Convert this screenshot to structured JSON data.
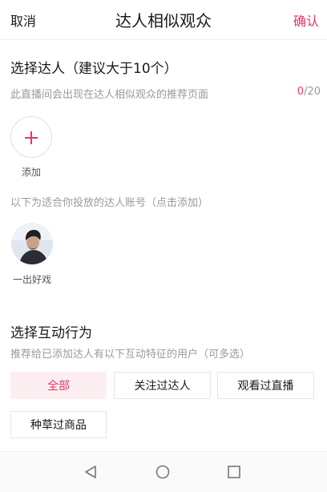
{
  "header": {
    "cancel_label": "取消",
    "title": "达人相似观众",
    "confirm_label": "确认"
  },
  "select_influencer": {
    "title": "选择达人（建议大于10个）",
    "hint": "此直播间会出现在达人相似观众的推荐页面",
    "count_current": "0",
    "count_total": "/20",
    "add_label": "添加"
  },
  "suggested": {
    "hint": "以下为适合你投放的达人账号（点击添加）",
    "accounts": [
      {
        "name": "一出好戏"
      }
    ]
  },
  "interaction": {
    "title": "选择互动行为",
    "hint": "推荐给已添加达人有以下互动特征的用户（可多选）",
    "options": [
      {
        "label": "全部",
        "selected": true
      },
      {
        "label": "关注过达人",
        "selected": false
      },
      {
        "label": "观看过直播",
        "selected": false
      },
      {
        "label": "种草过商品",
        "selected": false
      }
    ]
  },
  "colors": {
    "accent": "#e8356a",
    "hint_text": "#9a9a9a",
    "selected_chip_bg": "#fdeef2"
  },
  "icons": {
    "add": "plus-icon",
    "nav_back": "triangle-back-icon",
    "nav_home": "circle-home-icon",
    "nav_recents": "square-recents-icon"
  }
}
